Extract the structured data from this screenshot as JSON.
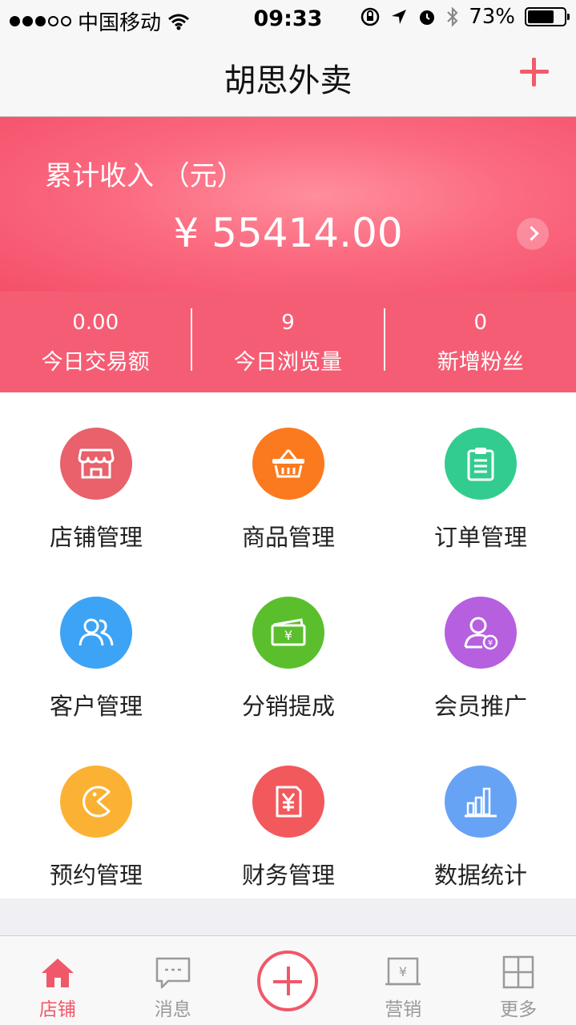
{
  "status_bar": {
    "carrier": "中国移动",
    "time": "09:33",
    "battery": "73%",
    "battery_level": 0.73
  },
  "nav": {
    "title": "胡思外卖",
    "add_icon": "plus-icon"
  },
  "income": {
    "label": "累计收入 （元）",
    "value": "¥ 55414.00"
  },
  "stats": [
    {
      "value": "0.00",
      "label": "今日交易额"
    },
    {
      "value": "9",
      "label": "今日浏览量"
    },
    {
      "value": "0",
      "label": "新增粉丝"
    }
  ],
  "grid": {
    "items": [
      {
        "label": "店铺管理",
        "icon": "store-icon",
        "color": "#e8616b"
      },
      {
        "label": "商品管理",
        "icon": "basket-icon",
        "color": "#fb7a1e"
      },
      {
        "label": "订单管理",
        "icon": "clipboard-icon",
        "color": "#33cc8f"
      },
      {
        "label": "客户管理",
        "icon": "users-icon",
        "color": "#3da3f5"
      },
      {
        "label": "分销提成",
        "icon": "cash-icon",
        "color": "#5bbf2d"
      },
      {
        "label": "会员推广",
        "icon": "member-icon",
        "color": "#b660e0"
      },
      {
        "label": "预约管理",
        "icon": "pacman-icon",
        "color": "#fbb234"
      },
      {
        "label": "财务管理",
        "icon": "yuan-icon",
        "color": "#f2595c"
      },
      {
        "label": "数据统计",
        "icon": "bar-chart-icon",
        "color": "#67a3f4"
      }
    ]
  },
  "tabs": [
    {
      "label": "店铺",
      "icon": "home-icon",
      "active": true
    },
    {
      "label": "消息",
      "icon": "message-icon",
      "active": false
    },
    {
      "label": "",
      "icon": "plus-circle-icon",
      "active": false
    },
    {
      "label": "营销",
      "icon": "marketing-icon",
      "active": false
    },
    {
      "label": "更多",
      "icon": "grid-icon",
      "active": false
    }
  ],
  "colors": {
    "accent": "#f0586a",
    "banner": "#fb6a80"
  }
}
